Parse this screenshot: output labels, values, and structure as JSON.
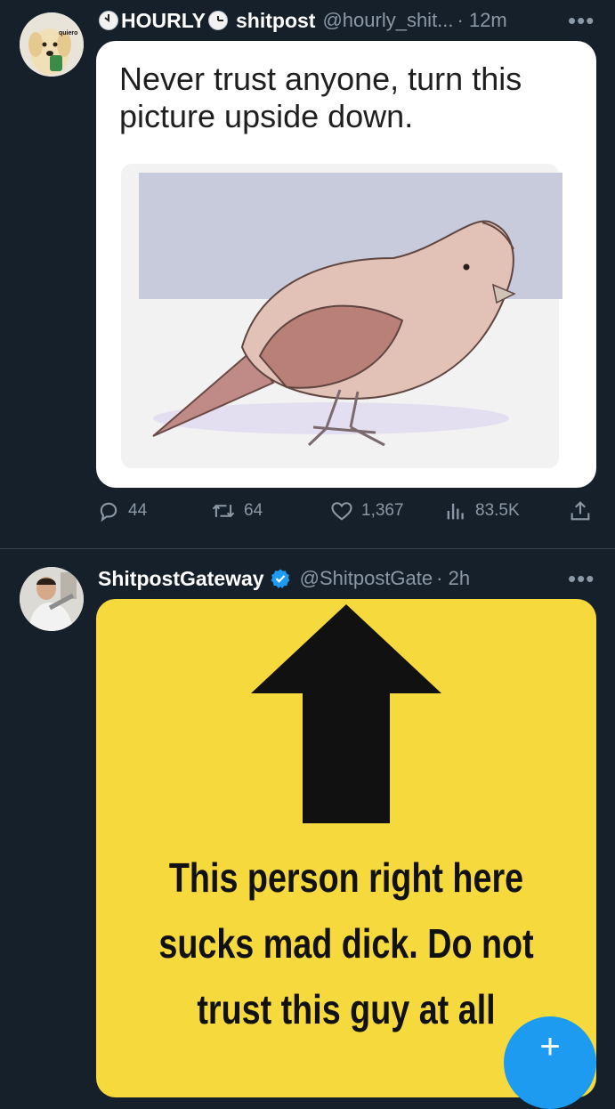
{
  "tweets": [
    {
      "display_name_parts": [
        "HOURLY",
        "shitpost"
      ],
      "handle": "@hourly_shit...",
      "time": "· 12m",
      "more": "•••",
      "avatar_text": "quiero",
      "image_caption": "Never trust anyone, turn this picture upside down.",
      "image_caption_lines": [
        "Never trust anyone, turn this",
        "picture upside down."
      ],
      "actions": {
        "replies": "44",
        "retweets": "64",
        "likes": "1,367",
        "views": "83.5K"
      },
      "icons": [
        "clock-icon",
        "reply-icon",
        "retweet-icon",
        "like-icon",
        "views-icon",
        "share-icon"
      ]
    },
    {
      "display_name": "ShitpostGateway",
      "verified": true,
      "handle": "@ShitpostGate",
      "time": "· 2h",
      "more": "•••",
      "sign_text_lines": [
        "This person right here",
        "sucks mad dick. Do not",
        "trust this guy at all"
      ]
    }
  ],
  "fab": {
    "label": "+"
  },
  "colors": {
    "background": "#15202b",
    "text_muted": "#8b98a5",
    "accent": "#1d9bf0",
    "sign_yellow": "#f6d93c"
  }
}
